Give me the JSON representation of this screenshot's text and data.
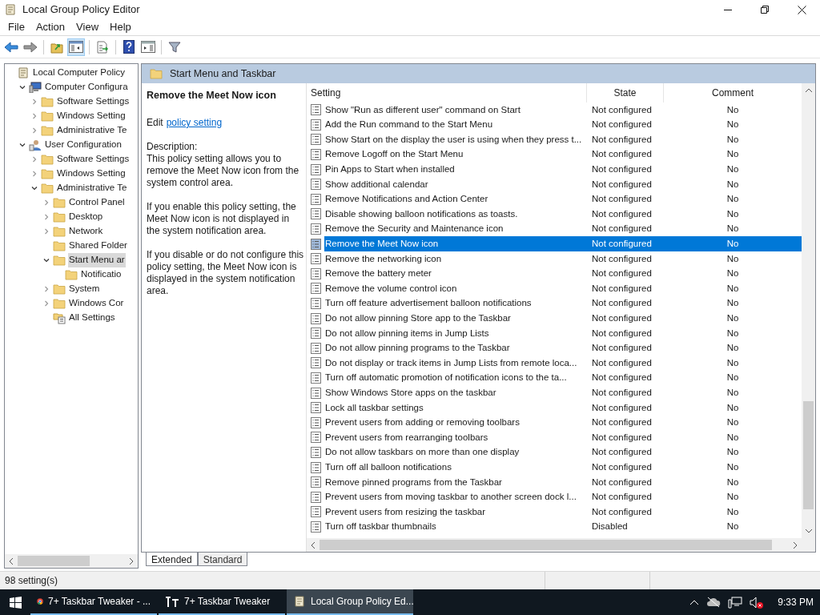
{
  "window": {
    "title": "Local Group Policy Editor"
  },
  "menu": [
    "File",
    "Action",
    "View",
    "Help"
  ],
  "toolbar": [
    {
      "kind": "back",
      "pressed": false
    },
    {
      "kind": "forward",
      "pressed": false
    },
    {
      "kind": "up",
      "pressed": false
    },
    {
      "kind": "tree",
      "pressed": true
    },
    {
      "kind": "export",
      "pressed": false
    },
    {
      "kind": "help",
      "pressed": false
    },
    {
      "kind": "pane",
      "pressed": false
    },
    {
      "kind": "filter",
      "pressed": false
    }
  ],
  "tree": [
    {
      "label": "Local Computer Policy",
      "kind": "policy",
      "selected": false,
      "children": [
        {
          "label": "Computer Configura",
          "kind": "computer",
          "expanded": true,
          "selected": false,
          "children": [
            {
              "label": "Software Settings",
              "kind": "folder",
              "expanded": false,
              "selected": false
            },
            {
              "label": "Windows Setting",
              "kind": "folder",
              "expanded": false,
              "selected": false
            },
            {
              "label": "Administrative Te",
              "kind": "folder",
              "expanded": false,
              "selected": false
            }
          ]
        },
        {
          "label": "User Configuration",
          "kind": "user",
          "expanded": true,
          "selected": false,
          "children": [
            {
              "label": "Software Settings",
              "kind": "folder",
              "expanded": false,
              "selected": false
            },
            {
              "label": "Windows Setting",
              "kind": "folder",
              "expanded": false,
              "selected": false
            },
            {
              "label": "Administrative Te",
              "kind": "folder",
              "expanded": true,
              "selected": false,
              "children": [
                {
                  "label": "Control Panel",
                  "kind": "folder",
                  "expanded": false,
                  "selected": false
                },
                {
                  "label": "Desktop",
                  "kind": "folder",
                  "expanded": false,
                  "selected": false
                },
                {
                  "label": "Network",
                  "kind": "folder",
                  "expanded": false,
                  "selected": false
                },
                {
                  "label": "Shared Folder",
                  "kind": "folder",
                  "selected": false
                },
                {
                  "label": "Start Menu ar",
                  "kind": "folder",
                  "expanded": true,
                  "selected": true,
                  "children": [
                    {
                      "label": "Notificatio",
                      "kind": "folder",
                      "selected": false
                    }
                  ]
                },
                {
                  "label": "System",
                  "kind": "folder",
                  "expanded": false,
                  "selected": false
                },
                {
                  "label": "Windows Cor",
                  "kind": "folder",
                  "expanded": false,
                  "selected": false
                },
                {
                  "label": "All Settings",
                  "kind": "settings",
                  "selected": false
                }
              ]
            }
          ]
        }
      ]
    }
  ],
  "header": "Start Menu and Taskbar",
  "description": {
    "title": "Remove the Meet Now icon",
    "edit_label": "Edit",
    "edit_link": "policy setting",
    "heading": "Description:",
    "paragraphs": [
      "This policy setting allows you to remove the Meet Now icon from the system control area.",
      "If you enable this policy setting, the Meet Now icon is not displayed in the system notification area.",
      "If you disable or do not configure this policy setting, the Meet Now icon is displayed in the system notification area."
    ]
  },
  "table": {
    "columns": [
      "Setting",
      "State",
      "Comment"
    ],
    "rows": [
      {
        "name": "Show \"Run as different user\" command on Start",
        "state": "Not configured",
        "comment": "No",
        "selected": false
      },
      {
        "name": "Add the Run command to the Start Menu",
        "state": "Not configured",
        "comment": "No",
        "selected": false
      },
      {
        "name": "Show Start on the display the user is using when they press t...",
        "state": "Not configured",
        "comment": "No",
        "selected": false
      },
      {
        "name": "Remove Logoff on the Start Menu",
        "state": "Not configured",
        "comment": "No",
        "selected": false
      },
      {
        "name": "Pin Apps to Start when installed",
        "state": "Not configured",
        "comment": "No",
        "selected": false
      },
      {
        "name": "Show additional calendar",
        "state": "Not configured",
        "comment": "No",
        "selected": false
      },
      {
        "name": "Remove Notifications and Action Center",
        "state": "Not configured",
        "comment": "No",
        "selected": false
      },
      {
        "name": "Disable showing balloon notifications as toasts.",
        "state": "Not configured",
        "comment": "No",
        "selected": false
      },
      {
        "name": "Remove the Security and Maintenance icon",
        "state": "Not configured",
        "comment": "No",
        "selected": false
      },
      {
        "name": "Remove the Meet Now icon",
        "state": "Not configured",
        "comment": "No",
        "selected": true
      },
      {
        "name": "Remove the networking icon",
        "state": "Not configured",
        "comment": "No",
        "selected": false
      },
      {
        "name": "Remove the battery meter",
        "state": "Not configured",
        "comment": "No",
        "selected": false
      },
      {
        "name": "Remove the volume control icon",
        "state": "Not configured",
        "comment": "No",
        "selected": false
      },
      {
        "name": "Turn off feature advertisement balloon notifications",
        "state": "Not configured",
        "comment": "No",
        "selected": false
      },
      {
        "name": "Do not allow pinning Store app to the Taskbar",
        "state": "Not configured",
        "comment": "No",
        "selected": false
      },
      {
        "name": "Do not allow pinning items in Jump Lists",
        "state": "Not configured",
        "comment": "No",
        "selected": false
      },
      {
        "name": "Do not allow pinning programs to the Taskbar",
        "state": "Not configured",
        "comment": "No",
        "selected": false
      },
      {
        "name": "Do not display or track items in Jump Lists from remote loca...",
        "state": "Not configured",
        "comment": "No",
        "selected": false
      },
      {
        "name": "Turn off automatic promotion of notification icons to the ta...",
        "state": "Not configured",
        "comment": "No",
        "selected": false
      },
      {
        "name": "Show Windows Store apps on the taskbar",
        "state": "Not configured",
        "comment": "No",
        "selected": false
      },
      {
        "name": "Lock all taskbar settings",
        "state": "Not configured",
        "comment": "No",
        "selected": false
      },
      {
        "name": "Prevent users from adding or removing toolbars",
        "state": "Not configured",
        "comment": "No",
        "selected": false
      },
      {
        "name": "Prevent users from rearranging toolbars",
        "state": "Not configured",
        "comment": "No",
        "selected": false
      },
      {
        "name": "Do not allow taskbars on more than one display",
        "state": "Not configured",
        "comment": "No",
        "selected": false
      },
      {
        "name": "Turn off all balloon notifications",
        "state": "Not configured",
        "comment": "No",
        "selected": false
      },
      {
        "name": "Remove pinned programs from the Taskbar",
        "state": "Not configured",
        "comment": "No",
        "selected": false
      },
      {
        "name": "Prevent users from moving taskbar to another screen dock l...",
        "state": "Not configured",
        "comment": "No",
        "selected": false
      },
      {
        "name": "Prevent users from resizing the taskbar",
        "state": "Not configured",
        "comment": "No",
        "selected": false
      },
      {
        "name": "Turn off taskbar thumbnails",
        "state": "Disabled",
        "comment": "No",
        "selected": false
      }
    ]
  },
  "view_tabs": [
    {
      "label": "Extended",
      "selected": true
    },
    {
      "label": "Standard",
      "selected": false
    }
  ],
  "status_bar": "98 setting(s)",
  "taskbar": {
    "items": [
      {
        "label": "7+ Taskbar Tweaker - ...",
        "kind": "browser",
        "selected": false
      },
      {
        "label": "7+ Taskbar Tweaker",
        "kind": "tweaker",
        "selected": false
      },
      {
        "label": "Local Group Policy Ed...",
        "kind": "policy",
        "selected": true
      }
    ],
    "clock": "9:33 PM"
  }
}
